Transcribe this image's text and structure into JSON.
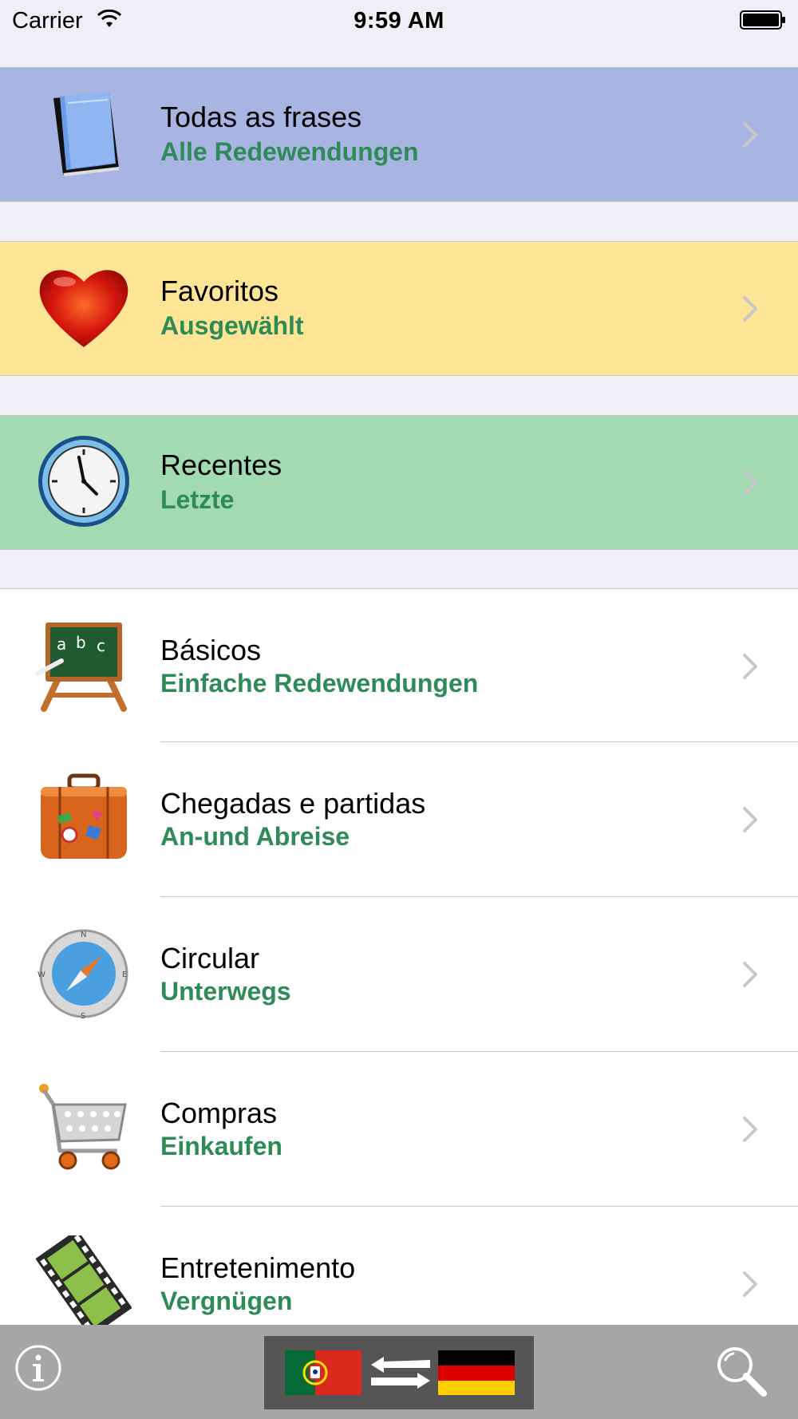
{
  "status_bar": {
    "carrier": "Carrier",
    "time": "9:59 AM",
    "wifi_icon": "wifi-icon",
    "battery_icon": "battery-icon"
  },
  "menu": {
    "featured": [
      {
        "title": "Todas as frases",
        "subtitle": "Alle Redewendungen",
        "icon": "book-icon",
        "background": "#a8b4e2"
      },
      {
        "title": "Favoritos",
        "subtitle": "Ausgewählt",
        "icon": "heart-icon",
        "background": "#fee495"
      },
      {
        "title": "Recentes",
        "subtitle": "Letzte",
        "icon": "clock-icon",
        "background": "#a2dbb2"
      }
    ],
    "categories": [
      {
        "title": "Básicos",
        "subtitle": "Einfache Redewendungen",
        "icon": "chalkboard-icon"
      },
      {
        "title": "Chegadas e partidas",
        "subtitle": "An-und Abreise",
        "icon": "suitcase-icon"
      },
      {
        "title": "Circular",
        "subtitle": "Unterwegs",
        "icon": "compass-icon"
      },
      {
        "title": "Compras",
        "subtitle": "Einkaufen",
        "icon": "shopping-cart-icon"
      },
      {
        "title": "Entretenimento",
        "subtitle": "Vergnügen",
        "icon": "film-icon"
      }
    ]
  },
  "toolbar": {
    "info_icon": "info-icon",
    "language_switch": {
      "from_flag": "portugal-flag-icon",
      "to_flag": "germany-flag-icon",
      "swap_icon": "swap-arrows-icon"
    },
    "search_icon": "search-icon"
  },
  "colors": {
    "subtitle_green": "#2e8b57",
    "toolbar_gray": "#a6a6a6",
    "chevron": "#c7c7cc"
  }
}
